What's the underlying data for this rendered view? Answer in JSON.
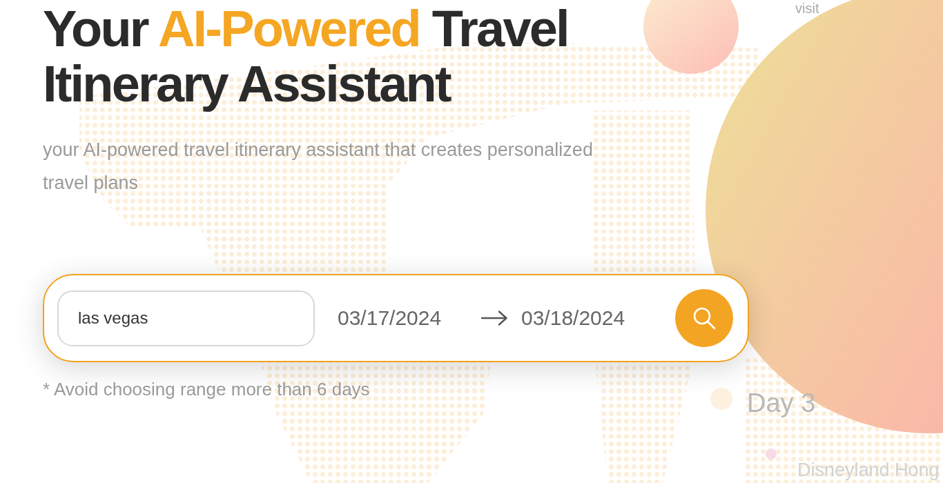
{
  "hero": {
    "title": [
      {
        "text": "Your ",
        "highlight": false
      },
      {
        "text": "AI-Powered",
        "highlight": true
      },
      {
        "text": " Travel Itinerary Assistant",
        "highlight": false
      }
    ],
    "subtitle": "your AI-powered travel itinerary assistant that creates personalized travel plans"
  },
  "search": {
    "destination": {
      "value": "las vegas"
    },
    "start_date": {
      "value": "03/17/2024"
    },
    "end_date": {
      "value": "03/18/2024"
    },
    "note": "* Avoid choosing range more than 6 days"
  },
  "itinerary_preview": {
    "texts": [
      {
        "kind": "note",
        "text": "visit"
      },
      {
        "kind": "day",
        "text": "Day 3"
      },
      {
        "kind": "place",
        "text": "Disneyland Hong"
      }
    ]
  }
}
